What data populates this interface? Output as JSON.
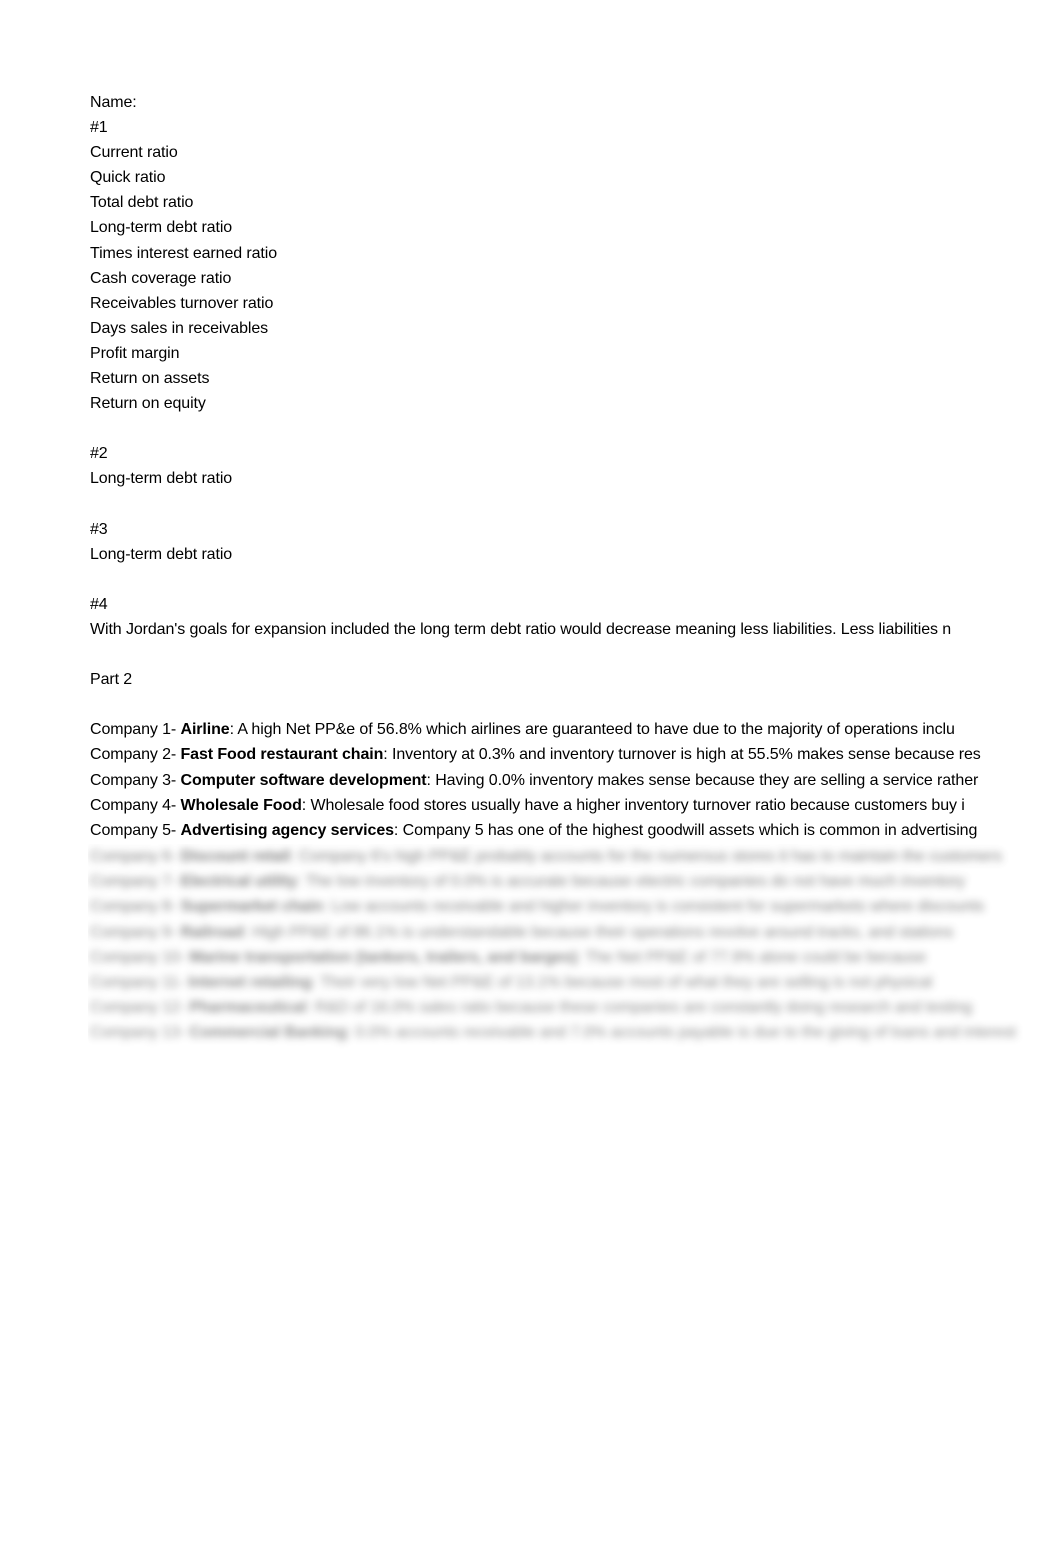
{
  "document": {
    "name_label": "Name:",
    "section1": {
      "heading": "#1",
      "ratios": [
        "Current ratio",
        "Quick ratio",
        "Total debt ratio",
        "Long-term debt ratio",
        "Times interest earned ratio",
        "Cash coverage ratio",
        "Receivables turnover ratio",
        "Days sales in receivables",
        "Profit margin",
        "Return on assets",
        "Return on equity"
      ]
    },
    "section2": {
      "heading": "#2",
      "item": "Long-term debt ratio"
    },
    "section3": {
      "heading": "#3",
      "item": "Long-term debt ratio"
    },
    "section4": {
      "heading": "#4",
      "text": "With Jordan's goals for expansion included the long term debt ratio would decrease meaning less liabilities. Less liabilities n"
    },
    "part2": {
      "heading": "Part 2",
      "companies": [
        {
          "prefix": "Company 1- ",
          "industry": "Airline",
          "text": ": A high Net PP&e of 56.8% which airlines are guaranteed to have due to the majority of operations inclu"
        },
        {
          "prefix": "Company 2- ",
          "industry": "Fast Food restaurant chain",
          "text": ": Inventory at 0.3% and inventory turnover is high at 55.5% makes sense because res"
        },
        {
          "prefix": "Company 3- ",
          "industry": "Computer software development",
          "text": ": Having 0.0% inventory makes sense because they are selling a service rather"
        },
        {
          "prefix": "Company 4- ",
          "industry": "Wholesale Food",
          "text": ": Wholesale food stores usually have a higher inventory turnover ratio because customers buy i"
        },
        {
          "prefix": "Company 5- ",
          "industry": "Advertising agency services",
          "text": ": Company 5 has one of the highest goodwill assets which is common in advertising"
        }
      ],
      "obscured_companies": [
        {
          "prefix": "Company 6- ",
          "industry": "Discount retail",
          "text": ": Company 6's high PP&E probably accounts for the numerous stores it has to maintain the customers"
        },
        {
          "prefix": "Company 7- ",
          "industry": "Electrical utility",
          "text": ": The low inventory of 0.0% is accurate because electric companies do not have much inventory"
        },
        {
          "prefix": "Company 8- ",
          "industry": "Supermarket chain",
          "text": ": Low accounts receivable and higher inventory is consistent for supermarkets where discounts"
        },
        {
          "prefix": "Company 9- ",
          "industry": "Railroad",
          "text": ": High PP&E of 86.1% is understandable because their operations revolve around tracks, and stations"
        },
        {
          "prefix": "Company 10- ",
          "industry": "Marine transportation (tankers, trailers, and barges)",
          "text": ": The Net PP&E of 77.9% alone could be because"
        },
        {
          "prefix": "Company 11- ",
          "industry": "Internet retailing",
          "text": ": Their very low Net PP&E of 13.1% because most of what they are selling is not physical"
        },
        {
          "prefix": "Company 12- ",
          "industry": "Pharmaceutical",
          "text": ": R&D of 16.0% sales ratio because these companies are constantly doing research and testing"
        },
        {
          "prefix": "Company 13- ",
          "industry": "Commercial Banking",
          "text": ": 0.0% accounts receivable and 7.0% accounts payable is due to the giving of loans and interest"
        }
      ]
    }
  }
}
